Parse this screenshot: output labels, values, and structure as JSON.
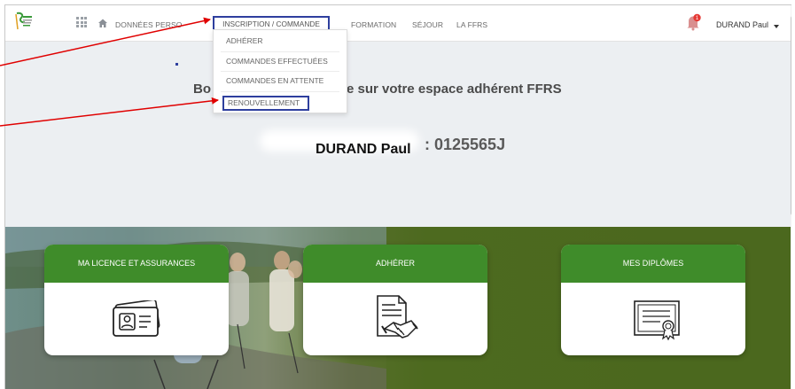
{
  "nav": {
    "items": [
      "DONNÉES PERSO",
      "INSCRIPTION / COMMANDE",
      "FORMATION",
      "SÉJOUR",
      "LA FFRS"
    ],
    "notification_count": "1",
    "user_name": "DURAND Paul"
  },
  "dropdown": {
    "items": [
      "ADHÉRER",
      "COMMANDES EFFECTUÉES",
      "COMMANDES EN ATTENTE",
      "RENOUVELLEMENT"
    ]
  },
  "welcome": {
    "part1": "Bo",
    "part2": "e sur votre espace adhérent FFRS"
  },
  "member": {
    "name": "DURAND Paul",
    "id": ": 0125565J"
  },
  "cards": [
    {
      "label": "MA LICENCE ET ASSURANCES",
      "icon": "id-card-icon"
    },
    {
      "label": "ADHÉRER",
      "icon": "contract-handshake-icon"
    },
    {
      "label": "MES DIPLÔMES",
      "icon": "diploma-icon"
    }
  ],
  "colors": {
    "card_header": "#3f8c2a",
    "highlight_box": "#2e3f9e",
    "annotation_arrow": "#e00000",
    "notification_badge": "#e53935"
  }
}
